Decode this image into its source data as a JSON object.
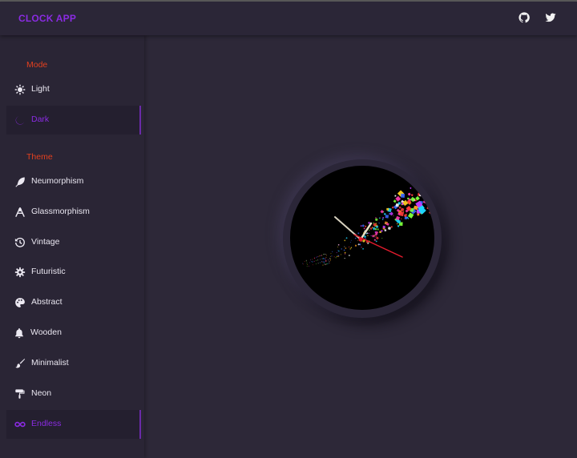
{
  "header": {
    "app_title": "CLOCK APP",
    "icons": [
      "github-icon",
      "twitter-icon"
    ]
  },
  "sidebar": {
    "mode_label": "Mode",
    "mode_items": [
      {
        "label": "Light",
        "icon": "sun-icon",
        "active": false
      },
      {
        "label": "Dark",
        "icon": "moon-icon",
        "active": true
      }
    ],
    "theme_label": "Theme",
    "theme_items": [
      {
        "label": "Neumorphism",
        "icon": "feather-icon",
        "active": false
      },
      {
        "label": "Glassmorphism",
        "icon": "glass-icon",
        "active": false
      },
      {
        "label": "Vintage",
        "icon": "history-icon",
        "active": false
      },
      {
        "label": "Futuristic",
        "icon": "cog-icon",
        "active": false
      },
      {
        "label": "Abstract",
        "icon": "palette-icon",
        "active": false
      },
      {
        "label": "Wooden",
        "icon": "bell-icon",
        "active": false
      },
      {
        "label": "Minimalist",
        "icon": "brush-icon",
        "active": false
      },
      {
        "label": "Neon",
        "icon": "paint-roller-icon",
        "active": false
      },
      {
        "label": "Endless",
        "icon": "infinity-icon",
        "active": true
      }
    ]
  },
  "colors": {
    "accent": "#8a2be2",
    "section_label": "#e3401f",
    "background": "#2d2838",
    "clock_face": "#000000",
    "second_hand": "#e31b2d",
    "hour_minute_hands": "#d8d2c0"
  }
}
